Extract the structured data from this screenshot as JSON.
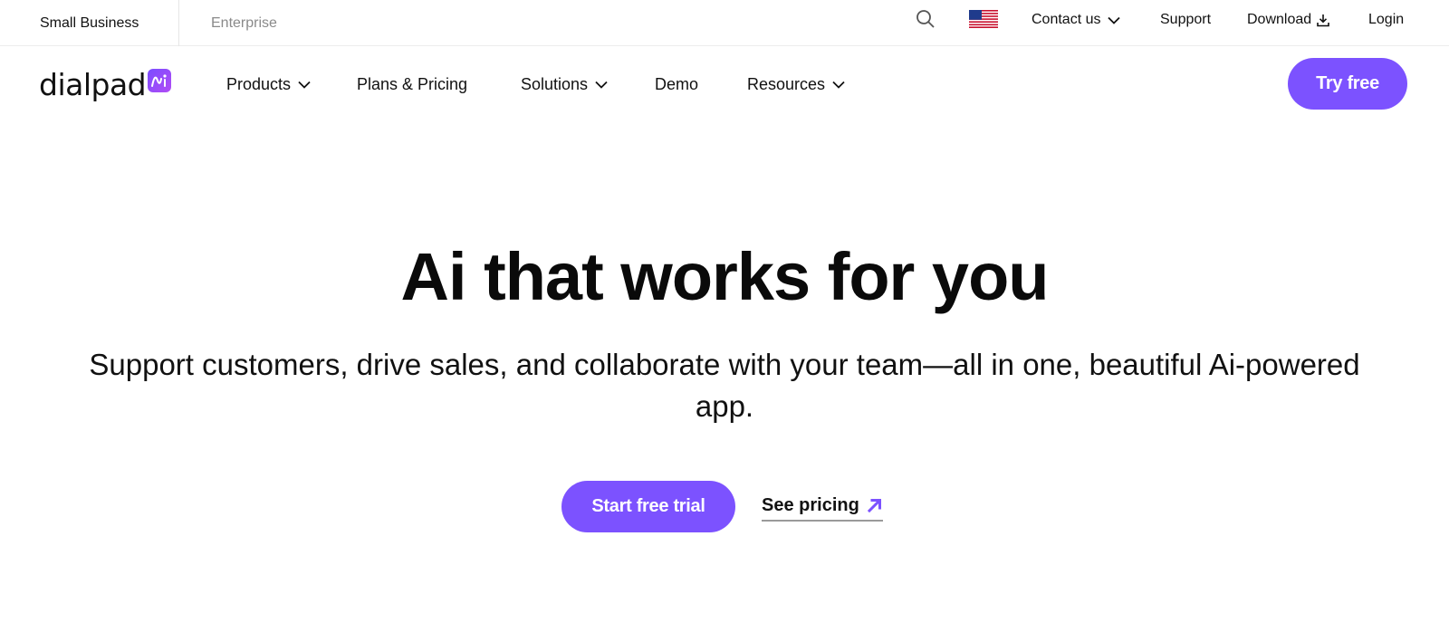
{
  "topbar": {
    "segments": [
      "Small Business",
      "Enterprise"
    ],
    "contact_label": "Contact us",
    "support_label": "Support",
    "download_label": "Download",
    "login_label": "Login"
  },
  "logo": {
    "text": "dialpad",
    "badge": "Ai"
  },
  "nav": {
    "products": "Products",
    "plans": "Plans & Pricing",
    "solutions": "Solutions",
    "demo": "Demo",
    "resources": "Resources",
    "cta": "Try free"
  },
  "hero": {
    "title": "Ai that works for you",
    "subtitle": "Support customers, drive sales, and collaborate with your team—all in one, beautiful Ai-powered app.",
    "primary_cta": "Start free trial",
    "secondary_cta": "See pricing"
  },
  "icons": {
    "search": "search-icon",
    "flag": "us-flag-icon",
    "chevron": "chevron-down-icon",
    "download": "download-icon",
    "arrow": "arrow-up-right-icon"
  },
  "colors": {
    "accent": "#7c52ff",
    "muted": "#8a8a8a"
  }
}
